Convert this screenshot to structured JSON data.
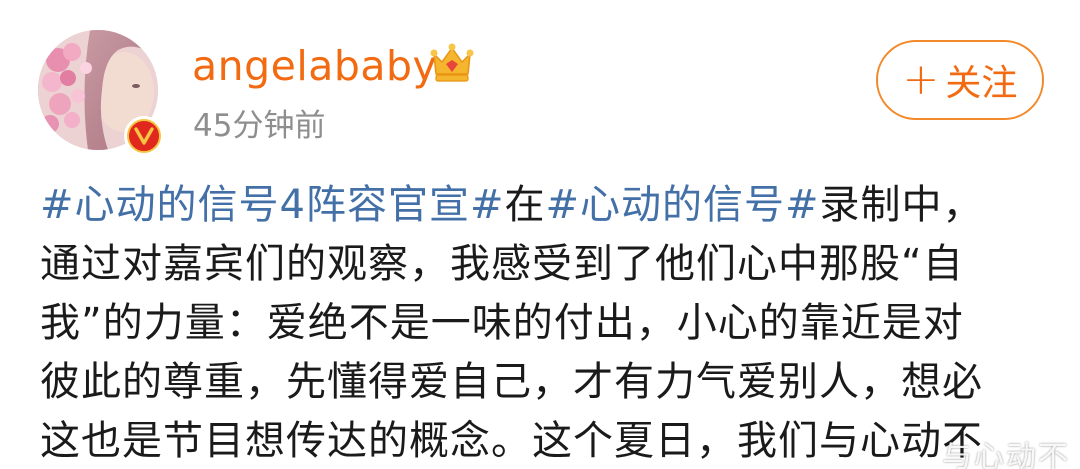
{
  "user": {
    "name": "angelababy",
    "timestamp": "45分钟前"
  },
  "follow": {
    "plus": "+",
    "label": "关注"
  },
  "post": {
    "line1": {
      "topic1": "#心动的信号4阵容官宣#",
      "mid": "在",
      "topic2": "#心动的信号#",
      "rest": "录制中，"
    },
    "line2": "通过对嘉宾们的观察，我感受到了他们心中那股“自",
    "line3": "我”的力量：爱绝不是一味的付出，小心的靠近是对",
    "line4": "彼此的尊重，先懂得爱自己，才有力气爱别人，想必",
    "line5": "这也是节目想传达的概念。这个夏日，我们与心动不"
  },
  "watermark": "与心动不",
  "colors": {
    "name": "#f26b12",
    "topic": "#4470a8",
    "text": "#1a1a1a",
    "timestamp": "#8e8e8e",
    "verified_badge": "#e0281e"
  },
  "icons": {
    "crown": "crown-icon",
    "verified": "verified-v-icon"
  }
}
